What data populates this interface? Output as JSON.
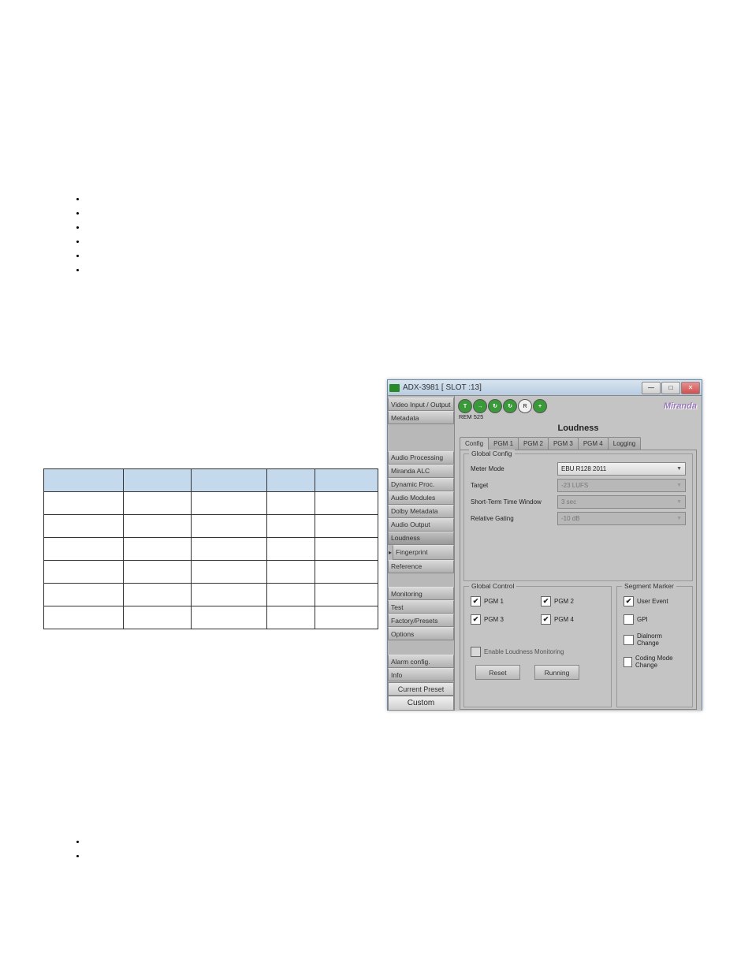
{
  "window": {
    "title": "ADX-3981 [ SLOT :13]",
    "logo": "Miranda",
    "sub_label": "REM 525"
  },
  "sidebar": {
    "items": [
      {
        "label": "Video Input / Output"
      },
      {
        "label": "Metadata"
      },
      {
        "label": "Audio Processing"
      },
      {
        "label": "Miranda ALC"
      },
      {
        "label": "Dynamic Proc."
      },
      {
        "label": "Audio Modules"
      },
      {
        "label": "Dolby Metadata"
      },
      {
        "label": "Audio Output"
      },
      {
        "label": "Loudness"
      },
      {
        "label": "Fingerprint"
      },
      {
        "label": "Reference"
      },
      {
        "label": "Monitoring"
      },
      {
        "label": "Test"
      },
      {
        "label": "Factory/Presets"
      },
      {
        "label": "Options"
      },
      {
        "label": "Alarm config."
      },
      {
        "label": "Info"
      }
    ],
    "current_preset": "Current Preset",
    "custom": "Custom"
  },
  "panel": {
    "title": "Loudness",
    "tabs": [
      "Config",
      "PGM 1",
      "PGM 2",
      "PGM 3",
      "PGM 4",
      "Logging"
    ]
  },
  "global_config": {
    "legend": "Global Config",
    "meter_mode_label": "Meter Mode",
    "meter_mode_value": "EBU R128 2011",
    "target_label": "Target",
    "target_value": "-23 LUFS",
    "window_label": "Short-Term Time Window",
    "window_value": "3 sec",
    "gating_label": "Relative Gating",
    "gating_value": "-10 dB"
  },
  "global_control": {
    "legend": "Global Control",
    "pgm1": "PGM 1",
    "pgm2": "PGM 2",
    "pgm3": "PGM 3",
    "pgm4": "PGM 4",
    "enable": "Enable Loudness Monitoring",
    "reset": "Reset",
    "running": "Running"
  },
  "segment_marker": {
    "legend": "Segment Marker",
    "user_event": "User Event",
    "gpi": "GPI",
    "dialnorm": "Dialnorm Change",
    "coding": "Coding Mode Change"
  },
  "status_icons": [
    "TP",
    "→",
    "↻",
    "↻",
    "REF",
    "+"
  ]
}
